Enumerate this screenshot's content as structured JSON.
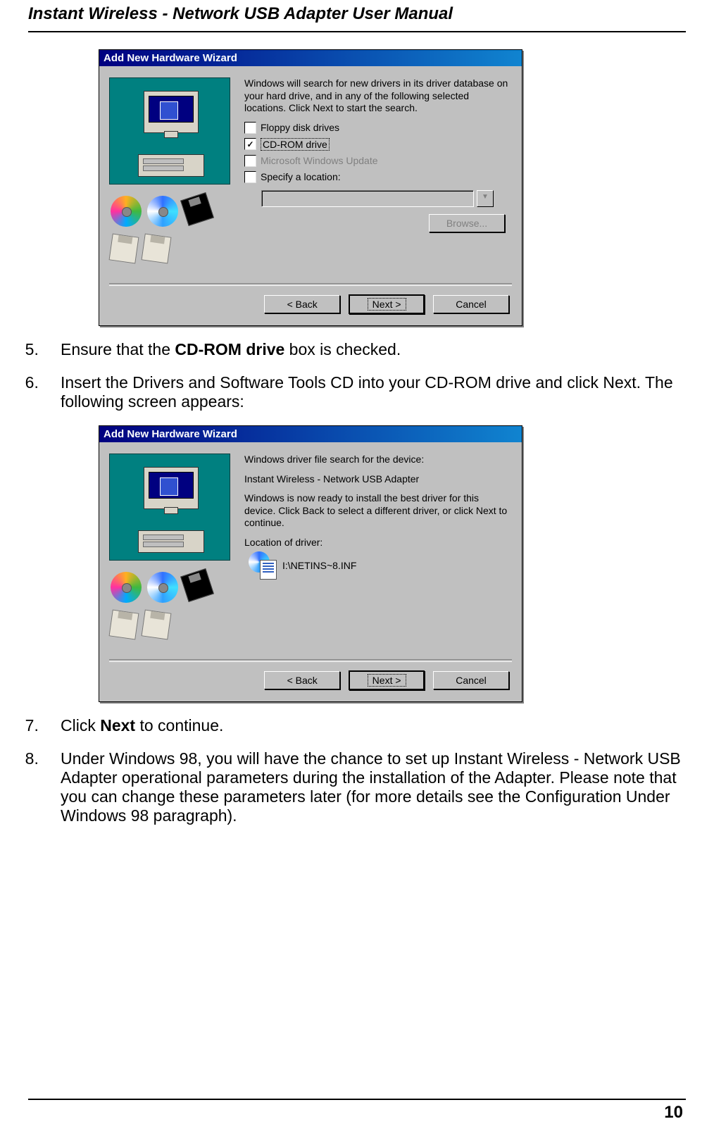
{
  "doc": {
    "title": "Instant Wireless - Network USB Adapter User Manual",
    "page_number": "10"
  },
  "dialog1": {
    "title": "Add New Hardware Wizard",
    "intro": "Windows will search for new drivers in its driver database on your hard drive, and in any of the following selected locations. Click Next to start the search.",
    "opt_floppy": "Floppy disk drives",
    "opt_cdrom": "CD-ROM drive",
    "opt_winupd": "Microsoft Windows Update",
    "opt_specify": "Specify a location:",
    "browse": "Browse...",
    "back": "< Back",
    "next": "Next >",
    "cancel": "Cancel"
  },
  "dialog2": {
    "title": "Add New Hardware Wizard",
    "line_search": "Windows driver file search for the device:",
    "device_name": "Instant Wireless - Network USB Adapter",
    "body": "Windows is now ready to install the best driver for this device. Click Back to select a different driver, or click Next to continue.",
    "loc_label": "Location of driver:",
    "loc_path": "I:\\NETINS~8.INF",
    "back": "< Back",
    "next": "Next >",
    "cancel": "Cancel"
  },
  "steps": {
    "s5_a": "Ensure that the ",
    "s5_b": "CD-ROM drive",
    "s5_c": " box is checked.",
    "s6": "Insert the Drivers and Software Tools CD into your CD-ROM drive and click Next. The following screen appears:",
    "s7_a": "Click ",
    "s7_b": "Next",
    "s7_c": " to continue.",
    "s8": "Under Windows 98, you will have the chance to set up Instant Wireless - Network USB Adapter operational parameters during the installation of the Adapter. Please note that you can change these parameters later    (for more details see the Configuration Under Windows 98 paragraph)."
  }
}
